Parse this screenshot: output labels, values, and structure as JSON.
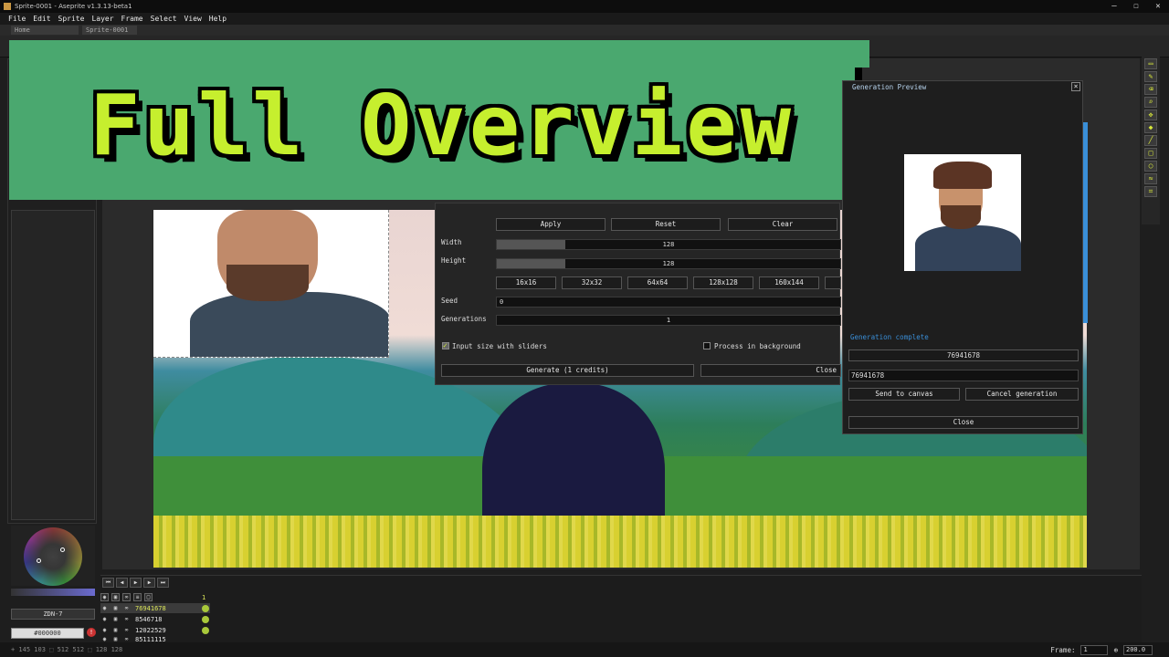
{
  "window": {
    "title": "Sprite-0001 - Aseprite v1.3.13-beta1",
    "controls": [
      "—",
      "☐",
      "✕"
    ]
  },
  "menu": [
    "File",
    "Edit",
    "Sprite",
    "Layer",
    "Frame",
    "Select",
    "View",
    "Help"
  ],
  "tabs": [
    "Home",
    "Sprite-0001"
  ],
  "banner": {
    "title": "Full Overview"
  },
  "settings": {
    "apply_label": "Apply",
    "reset_label": "Reset",
    "clear_label": "Clear",
    "width_label": "Width",
    "width_value": "128",
    "width_fraction": 0.2,
    "height_label": "Height",
    "height_value": "128",
    "height_fraction": 0.2,
    "size_presets": [
      "16x16",
      "32x32",
      "64x64",
      "128x128",
      "160x144"
    ],
    "seed_label": "Seed",
    "seed_value": "0",
    "generations_label": "Generations",
    "generations_value": "1",
    "input_size_label": "Input size with sliders",
    "input_size_checked": true,
    "process_bg_label": "Process in background",
    "process_bg_checked": false,
    "generate_label": "Generate (1 credits)",
    "close_label": "Close"
  },
  "preview": {
    "title": "Generation Preview",
    "status": "Generation complete",
    "seed_display": "76941678",
    "seed_input": "76941678",
    "send_label": "Send to canvas",
    "cancel_label": "Cancel generation",
    "close_label": "Close"
  },
  "color_panel": {
    "palette_name": "ZDN-7",
    "fg_color": "#000000",
    "warning_icon": "!"
  },
  "timeline": {
    "frame_header": "1",
    "layers": [
      {
        "name": "76941678",
        "active": true
      },
      {
        "name": "8546718",
        "active": false
      },
      {
        "name": "12022529",
        "active": false
      },
      {
        "name": "85111115",
        "active": false
      }
    ]
  },
  "status": {
    "info": "+ 145 103  ⬚ 512 512  ⬚ 128 128",
    "frame_label": "Frame:",
    "frame_value": "1",
    "zoom_value": "200.0"
  },
  "colors": {
    "banner_bg": "#4aa86f",
    "banner_text": "#c6ef2e",
    "accent_blue": "#3a8fd8",
    "accent_yellow": "#dde85a"
  }
}
